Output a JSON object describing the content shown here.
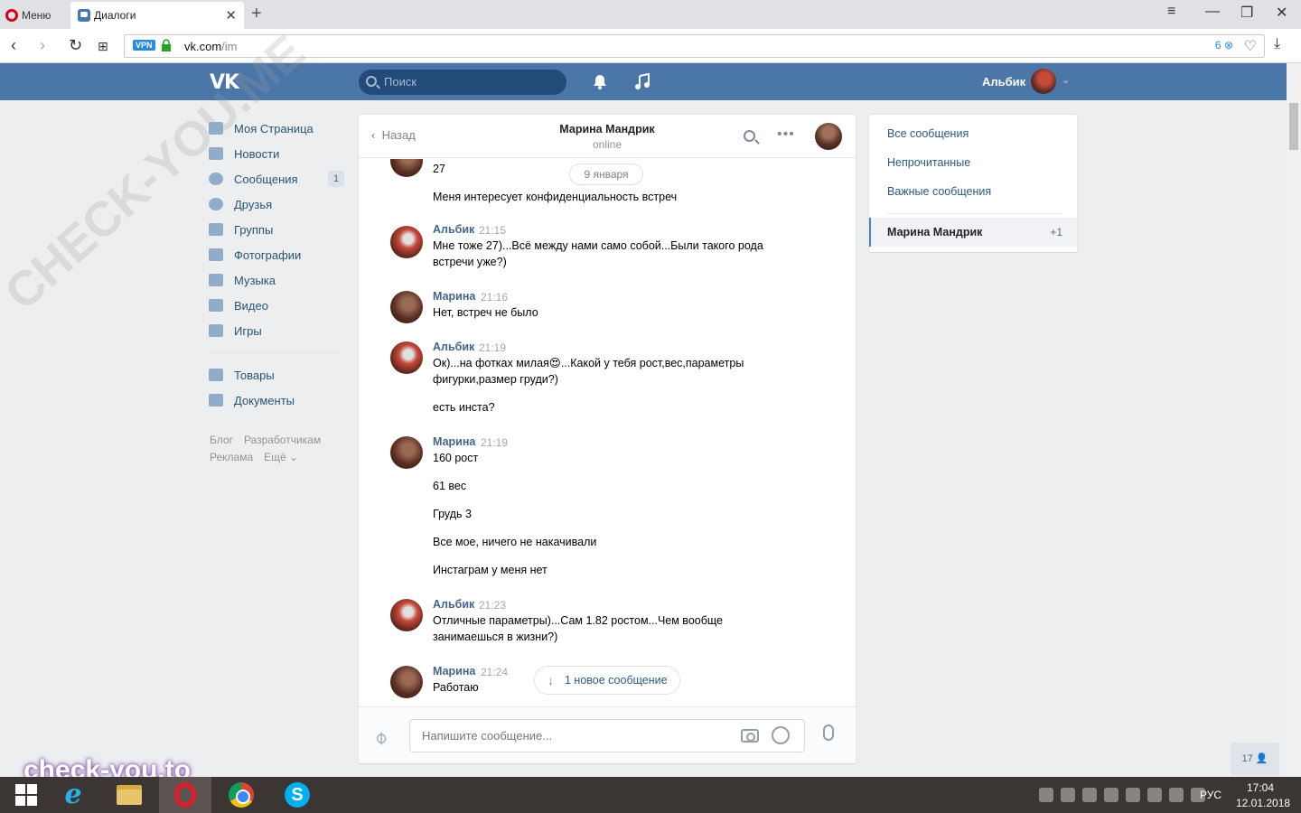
{
  "browser": {
    "menu_label": "Меню",
    "tab_title": "Диалоги",
    "url_host": "vk.com",
    "url_path": "/im",
    "vpn_label": "VPN",
    "adblock_count": "6"
  },
  "header": {
    "search_placeholder": "Поиск",
    "user_name": "Альбик"
  },
  "sidebar": {
    "items": [
      {
        "label": "Моя Страница",
        "icon": "home-icon"
      },
      {
        "label": "Новости",
        "icon": "news-icon"
      },
      {
        "label": "Сообщения",
        "icon": "messages-icon",
        "count": "1"
      },
      {
        "label": "Друзья",
        "icon": "friends-icon"
      },
      {
        "label": "Группы",
        "icon": "groups-icon"
      },
      {
        "label": "Фотографии",
        "icon": "camera-icon"
      },
      {
        "label": "Музыка",
        "icon": "music-icon"
      },
      {
        "label": "Видео",
        "icon": "video-icon"
      },
      {
        "label": "Игры",
        "icon": "games-icon"
      }
    ],
    "extra": [
      {
        "label": "Товары",
        "icon": "bag-icon"
      },
      {
        "label": "Документы",
        "icon": "document-icon"
      }
    ],
    "footer": [
      "Блог",
      "Разработчикам",
      "Реклама",
      "Ещё ⌄"
    ]
  },
  "chat": {
    "back_label": "Назад",
    "peer_name": "Марина Мандрик",
    "peer_status": "online",
    "date_chip": "9 января",
    "new_message_button": "1 новое сообщение",
    "input_placeholder": "Напишите сообщение...",
    "messages": [
      {
        "author": "",
        "time": "",
        "lines": [
          "27",
          "Меня интересует конфиденциальность встреч"
        ]
      },
      {
        "author": "Альбик",
        "time": "21:15",
        "lines": [
          "Мне тоже 27)...Всё между нами само собой...Были такого рода встречи уже?)"
        ]
      },
      {
        "author": "Марина",
        "time": "21:16",
        "lines": [
          "Нет, встреч не было"
        ]
      },
      {
        "author": "Альбик",
        "time": "21:19",
        "lines": [
          "Ок)...на фотках милая😍...Какой у тебя рост,вес,параметры фигурки,размер груди?)",
          "есть инста?"
        ]
      },
      {
        "author": "Марина",
        "time": "21:19",
        "lines": [
          "160 рост",
          "61 вес",
          "Грудь 3",
          "Все мое, ничего не накачивали",
          "Инстаграм у меня нет"
        ]
      },
      {
        "author": "Альбик",
        "time": "21:23",
        "lines": [
          "Отличные параметры)...Сам 1.82 ростом...Чем вообще занимаешься в жизни?)"
        ]
      },
      {
        "author": "Марина",
        "time": "21:24",
        "lines": [
          "Работаю"
        ]
      }
    ]
  },
  "right_panel": {
    "filters": [
      "Все сообщения",
      "Непрочитанные",
      "Важные сообщения"
    ],
    "selected_dialog": "Марина Мандрик",
    "selected_count": "+1"
  },
  "online_friends_count": "17",
  "taskbar": {
    "language": "РУС",
    "time": "17:04",
    "date": "12.01.2018"
  },
  "watermarks": [
    "CHECK-YOU.ME",
    "check-you.to"
  ],
  "colors": {
    "vk_blue": "#4a76a8",
    "link": "#2a5885",
    "author": "#42648b"
  }
}
